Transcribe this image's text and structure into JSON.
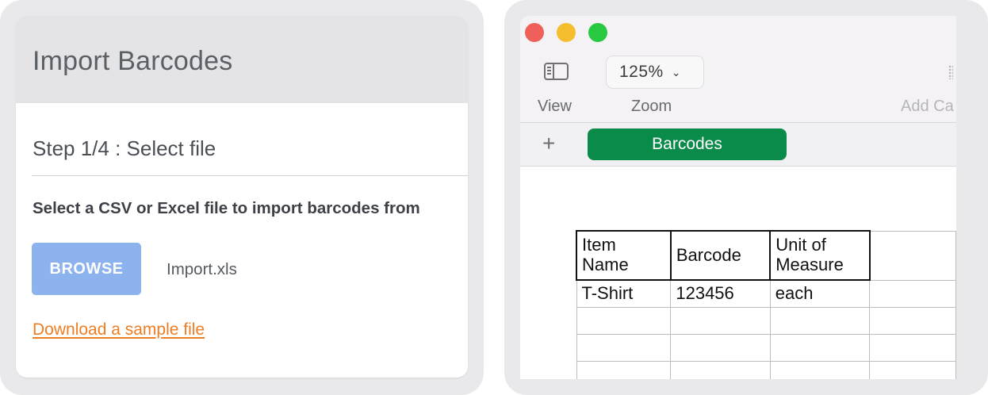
{
  "import_dialog": {
    "title": "Import Barcodes",
    "step_title": "Step 1/4 : Select file",
    "instruction": "Select a CSV or Excel file to import barcodes from",
    "browse_label": "BROWSE",
    "selected_file": "Import.xls",
    "sample_link": "Download a sample file",
    "colors": {
      "browse_button": "#8db3ef",
      "link": "#ef7d22"
    }
  },
  "spreadsheet": {
    "window_controls": [
      "close",
      "minimize",
      "maximize"
    ],
    "toolbar": {
      "view_label": "View",
      "view_icon": "sidebar-icon",
      "zoom_value": "125%",
      "zoom_label": "Zoom",
      "add_label": "Add Ca"
    },
    "tabs": [
      {
        "label": "Barcodes",
        "active": true
      }
    ],
    "table": {
      "headers": [
        [
          "Item",
          "Name"
        ],
        [
          "Barcode"
        ],
        [
          "Unit of",
          "Measure"
        ],
        [
          ""
        ]
      ],
      "rows": [
        [
          "T-Shirt",
          "123456",
          "each",
          ""
        ],
        [
          "",
          "",
          "",
          ""
        ],
        [
          "",
          "",
          "",
          ""
        ],
        [
          "",
          "",
          "",
          ""
        ]
      ]
    },
    "colors": {
      "active_tab": "#0b8b4a"
    }
  }
}
